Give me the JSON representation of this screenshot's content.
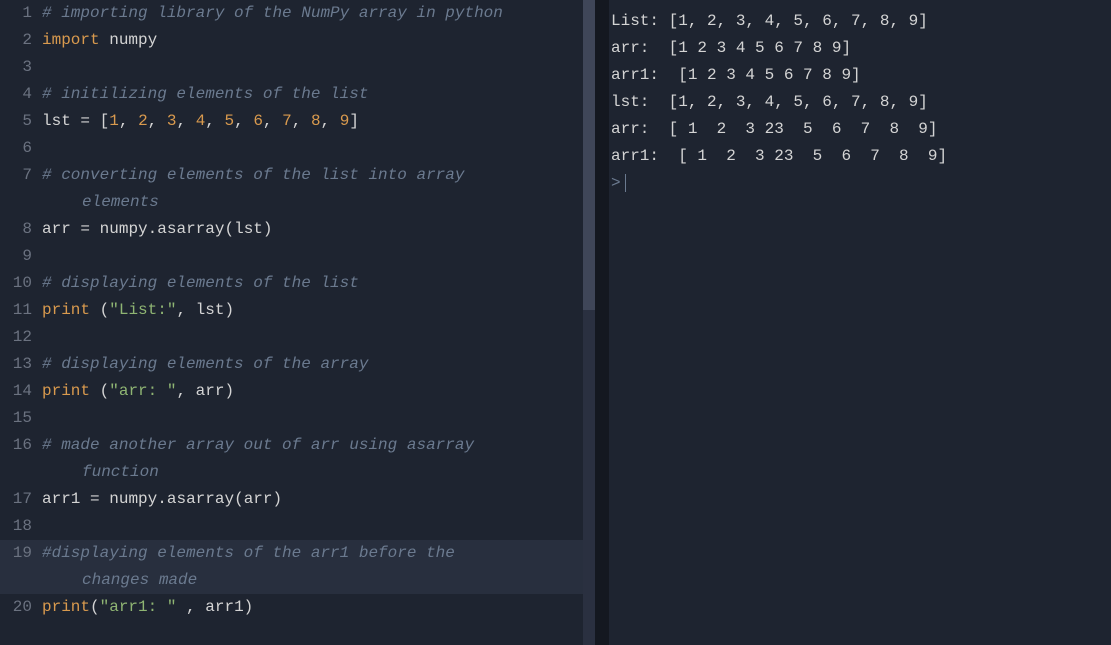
{
  "editor": {
    "lines": [
      {
        "num": "1",
        "type": "comment_import",
        "comment": "# importing library of the NumPy array in python"
      },
      {
        "num": "2",
        "type": "import",
        "kw": "import",
        "mod": "numpy"
      },
      {
        "num": "3",
        "type": "blank"
      },
      {
        "num": "4",
        "type": "comment",
        "text": "# initilizing elements of the list"
      },
      {
        "num": "5",
        "type": "assign_list",
        "var": "lst",
        "op": "=",
        "vals": [
          "1",
          "2",
          "3",
          "4",
          "5",
          "6",
          "7",
          "8",
          "9"
        ]
      },
      {
        "num": "6",
        "type": "blank"
      },
      {
        "num": "7",
        "type": "comment_wrap",
        "text": "# converting elements of the list into array ",
        "wrap": "elements"
      },
      {
        "num": "8",
        "type": "assign_call",
        "var": "arr",
        "op": "=",
        "obj": "numpy",
        "method": "asarray",
        "arg": "lst"
      },
      {
        "num": "9",
        "type": "blank"
      },
      {
        "num": "10",
        "type": "comment",
        "text": "# displaying elements of the list"
      },
      {
        "num": "11",
        "type": "print",
        "fn": "print",
        "str": "\"List:\"",
        "arg": "lst",
        "space": true
      },
      {
        "num": "12",
        "type": "blank"
      },
      {
        "num": "13",
        "type": "comment",
        "text": "# displaying elements of the array"
      },
      {
        "num": "14",
        "type": "print",
        "fn": "print",
        "str": "\"arr: \"",
        "arg": "arr",
        "space": true
      },
      {
        "num": "15",
        "type": "blank"
      },
      {
        "num": "16",
        "type": "comment_wrap",
        "text": "# made another array out of arr using asarray ",
        "wrap": "function"
      },
      {
        "num": "17",
        "type": "assign_call",
        "var": "arr1",
        "op": "=",
        "obj": "numpy",
        "method": "asarray",
        "arg": "arr"
      },
      {
        "num": "18",
        "type": "blank"
      },
      {
        "num": "19",
        "type": "comment_wrap_active",
        "text": "#displaying elements of the arr1 before the ",
        "wrap": "changes made"
      },
      {
        "num": "20",
        "type": "print_nospace",
        "fn": "print",
        "str": "\"arr1: \"",
        "arg": "arr1"
      }
    ]
  },
  "output": {
    "lines": [
      "List: [1, 2, 3, 4, 5, 6, 7, 8, 9]",
      "arr:  [1 2 3 4 5 6 7 8 9]",
      "arr1:  [1 2 3 4 5 6 7 8 9]",
      "lst:  [1, 2, 3, 4, 5, 6, 7, 8, 9]",
      "arr:  [ 1  2  3 23  5  6  7  8  9]",
      "arr1:  [ 1  2  3 23  5  6  7  8  9]"
    ],
    "prompt": ">"
  }
}
